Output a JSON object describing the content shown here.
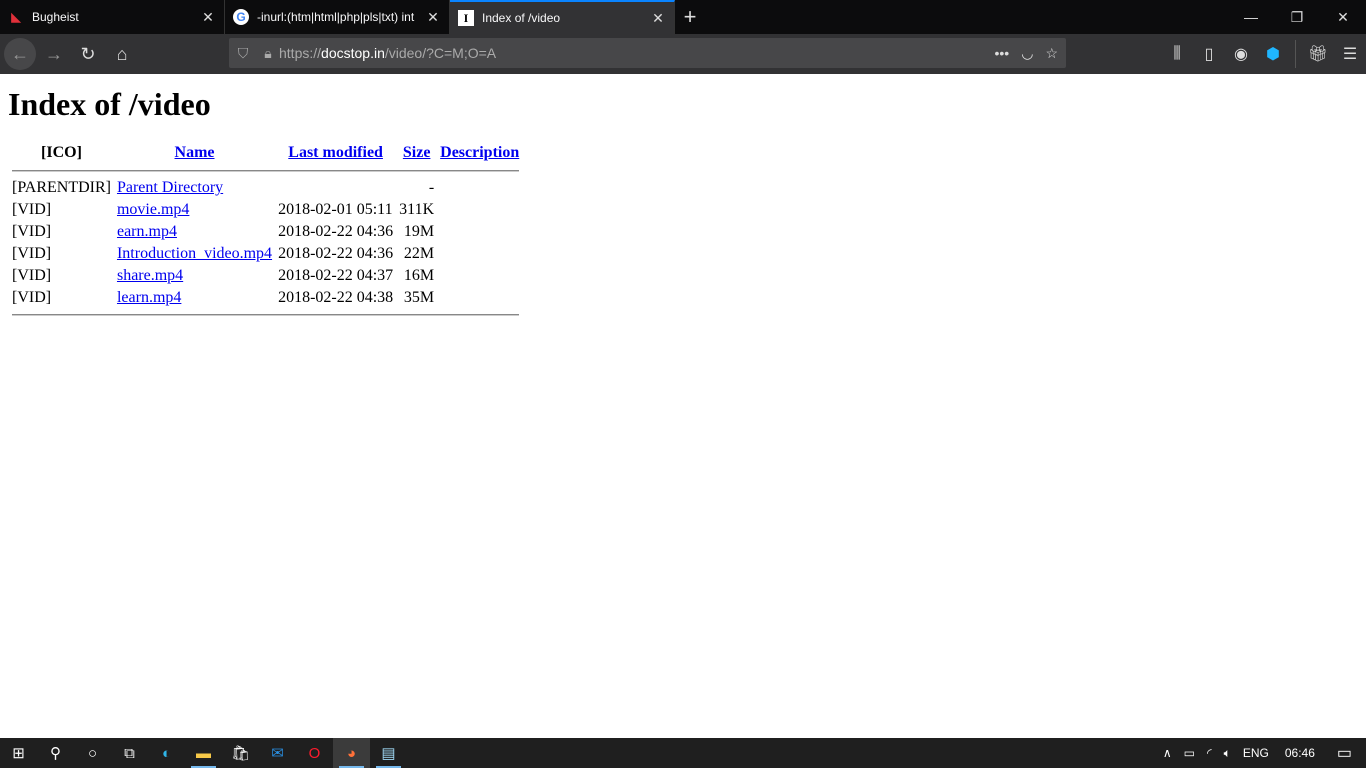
{
  "browser": {
    "tabs": [
      {
        "title": "Bugheist",
        "icon": "bugheist-logo-icon",
        "active": false
      },
      {
        "title": "-inurl:(htm|html|php|pls|txt) int",
        "icon": "google-icon",
        "active": false
      },
      {
        "title": "Index of /video",
        "icon": "text-cursor-icon",
        "active": true
      }
    ],
    "url_prefix": "https://",
    "url_host": "docstop.in",
    "url_path": "/video/?C=M;O=A",
    "accent": "#0a84ff"
  },
  "page": {
    "title": "Index of /video",
    "headers": {
      "ico": "[ICO]",
      "name": "Name",
      "modified": "Last modified",
      "size": "Size",
      "description": "Description"
    },
    "rows": [
      {
        "ico": "[PARENTDIR]",
        "name": "Parent Directory",
        "modified": "",
        "size": "-",
        "description": ""
      },
      {
        "ico": "[VID]",
        "name": "movie.mp4",
        "modified": "2018-02-01 05:11",
        "size": "311K",
        "description": ""
      },
      {
        "ico": "[VID]",
        "name": "earn.mp4",
        "modified": "2018-02-22 04:36",
        "size": "19M",
        "description": ""
      },
      {
        "ico": "[VID]",
        "name": "Introduction_video.mp4",
        "modified": "2018-02-22 04:36",
        "size": "22M",
        "description": ""
      },
      {
        "ico": "[VID]",
        "name": "share.mp4",
        "modified": "2018-02-22 04:37",
        "size": "16M",
        "description": ""
      },
      {
        "ico": "[VID]",
        "name": "learn.mp4",
        "modified": "2018-02-22 04:38",
        "size": "35M",
        "description": ""
      }
    ]
  },
  "taskbar": {
    "language": "ENG",
    "time": "06:46"
  }
}
